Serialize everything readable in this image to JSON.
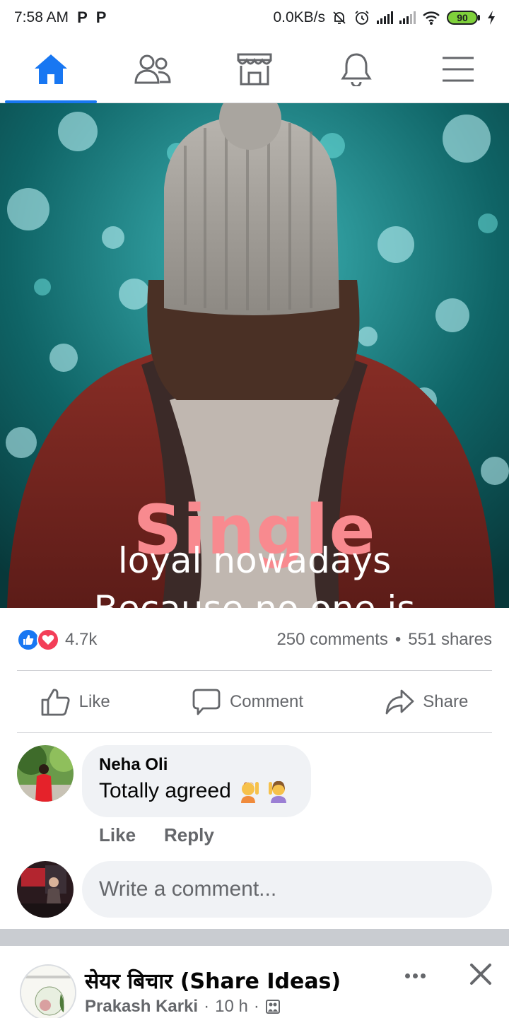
{
  "status_bar": {
    "time": "7:58 AM",
    "left_glyphs": [
      "P",
      "P"
    ],
    "network_speed": "0.0KB/s",
    "battery_level": "90",
    "icons": [
      "mute-icon",
      "alarm-icon",
      "signal-icon",
      "signal-icon",
      "wifi-icon",
      "battery-icon",
      "charging-icon"
    ]
  },
  "nav": {
    "tabs": [
      {
        "icon": "home-icon",
        "active": true
      },
      {
        "icon": "friends-icon",
        "active": false
      },
      {
        "icon": "marketplace-icon",
        "active": false
      },
      {
        "icon": "notifications-icon",
        "active": false
      },
      {
        "icon": "menu-icon",
        "active": false
      }
    ],
    "active_color": "#1877f2"
  },
  "post": {
    "image_overlay": {
      "title": "Single",
      "line1": "Because no one is",
      "line2": "loyal nowadays"
    },
    "reaction_count": "4.7k",
    "comments_count": "250 comments",
    "separator": "•",
    "shares_count": "551 shares",
    "actions": {
      "like": "Like",
      "comment": "Comment",
      "share": "Share"
    }
  },
  "comment": {
    "author": "Neha Oli",
    "text": "Totally agreed",
    "like": "Like",
    "reply": "Reply"
  },
  "composer": {
    "placeholder": "Write a comment..."
  },
  "next_post": {
    "page_name": "सेयर बिचार (Share Ideas)",
    "author": "Prakash Karki",
    "time": "10 h",
    "dot": "·"
  },
  "colors": {
    "brand": "#1877f2",
    "love": "#f33e58",
    "secondary_text": "#65676b",
    "overlay_title": "#f88a8f"
  }
}
